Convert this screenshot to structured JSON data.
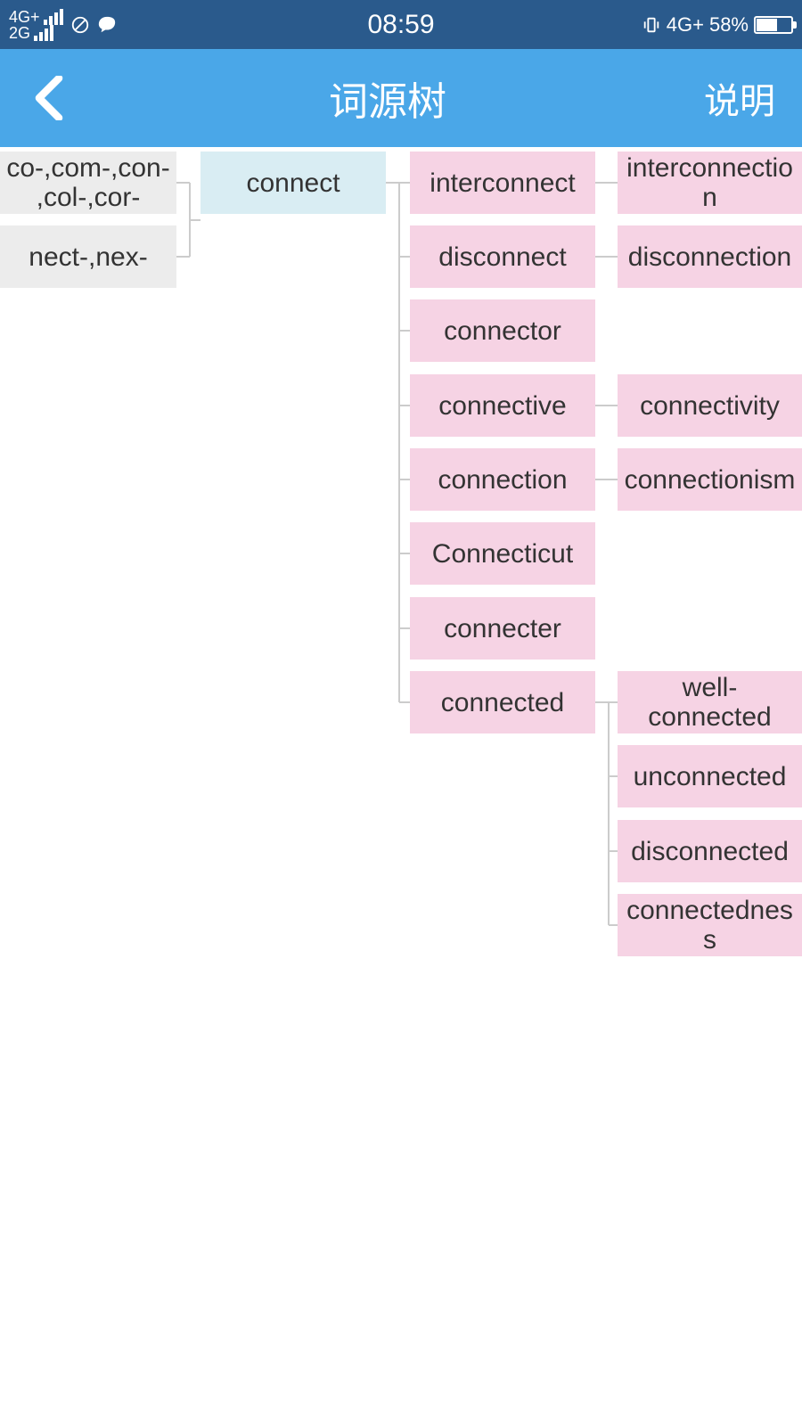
{
  "status": {
    "net1": "4G+",
    "net2": "2G",
    "time": "08:59",
    "net3": "4G+",
    "battery": "58%"
  },
  "nav": {
    "title": "词源树",
    "action": "说明"
  },
  "nodes": {
    "root1": "co-,com-,con-,col-,cor-",
    "root2": "nect-,nex-",
    "main": "connect",
    "c1": "interconnect",
    "c2": "disconnect",
    "c3": "connector",
    "c4": "connective",
    "c5": "connection",
    "c6": "Connecticut",
    "c7": "connecter",
    "c8": "connected",
    "d1": "interconnection",
    "d2": "disconnection",
    "d4": "connectivity",
    "d5": "connectionism",
    "d8a": "well-connected",
    "d8b": "unconnected",
    "d8c": "disconnected",
    "d8d": "connectedness"
  }
}
